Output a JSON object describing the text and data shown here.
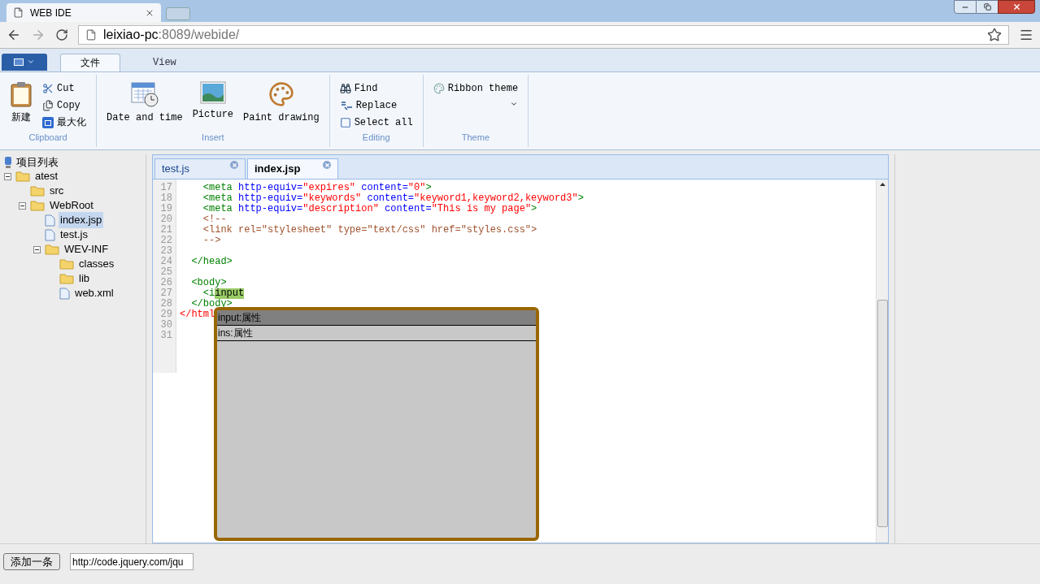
{
  "browser": {
    "tab_title": "WEB IDE",
    "url_host": "leixiao-pc",
    "url_path": ":8089/webide/"
  },
  "ribbon": {
    "tabs": [
      {
        "label": "文件",
        "selected": true
      },
      {
        "label": "View",
        "selected": false
      }
    ],
    "groups": [
      {
        "label": "Clipboard",
        "items": [
          {
            "label": "新建",
            "kind": "large"
          },
          {
            "label": "Cut",
            "kind": "small"
          },
          {
            "label": "Copy",
            "kind": "small"
          },
          {
            "label": "最大化",
            "kind": "small"
          }
        ]
      },
      {
        "label": "Insert",
        "items": [
          {
            "label": "Date and time",
            "kind": "large"
          },
          {
            "label": "Picture",
            "kind": "large"
          },
          {
            "label": "Paint drawing",
            "kind": "large"
          }
        ]
      },
      {
        "label": "Editing",
        "items": [
          {
            "label": "Find",
            "kind": "small"
          },
          {
            "label": "Replace",
            "kind": "small"
          },
          {
            "label": "Select all",
            "kind": "small"
          }
        ]
      },
      {
        "label": "Theme",
        "items": [
          {
            "label": "Ribbon theme",
            "kind": "dropdown"
          }
        ]
      }
    ]
  },
  "tree": {
    "title": "项目列表",
    "items": [
      {
        "label": "atest",
        "kind": "folder",
        "expanded": true,
        "selected": false,
        "children": [
          {
            "label": "src",
            "kind": "folder",
            "selected": false
          },
          {
            "label": "WebRoot",
            "kind": "folder",
            "expanded": true,
            "selected": false,
            "children": [
              {
                "label": "index.jsp",
                "kind": "file",
                "selected": true
              },
              {
                "label": "test.js",
                "kind": "file",
                "selected": false
              },
              {
                "label": "WEV-INF",
                "kind": "folder",
                "expanded": true,
                "selected": false,
                "children": [
                  {
                    "label": "classes",
                    "kind": "folder",
                    "selected": false
                  },
                  {
                    "label": "lib",
                    "kind": "folder",
                    "selected": false
                  },
                  {
                    "label": "web.xml",
                    "kind": "file",
                    "selected": false
                  }
                ]
              }
            ]
          }
        ]
      }
    ]
  },
  "editor": {
    "tabs": [
      {
        "label": "test.js",
        "selected": false
      },
      {
        "label": "index.jsp",
        "selected": true
      }
    ],
    "lines": [
      {
        "num": "17",
        "tokens": [
          {
            "text": "    <meta ",
            "kind": "tag"
          },
          {
            "text": "http-equiv=",
            "kind": "attr"
          },
          {
            "text": "\"expires\" ",
            "kind": "str"
          },
          {
            "text": "content=",
            "kind": "attr"
          },
          {
            "text": "\"0\"",
            "kind": "str"
          },
          {
            "text": ">",
            "kind": "tag"
          }
        ]
      },
      {
        "num": "18",
        "tokens": [
          {
            "text": "    <meta ",
            "kind": "tag"
          },
          {
            "text": "http-equiv=",
            "kind": "attr"
          },
          {
            "text": "\"keywords\" ",
            "kind": "str"
          },
          {
            "text": "content=",
            "kind": "attr"
          },
          {
            "text": "\"keyword1,keyword2,keyword3\"",
            "kind": "str"
          },
          {
            "text": ">",
            "kind": "tag"
          }
        ]
      },
      {
        "num": "19",
        "tokens": [
          {
            "text": "    <meta ",
            "kind": "tag"
          },
          {
            "text": "http-equiv=",
            "kind": "attr"
          },
          {
            "text": "\"description\" ",
            "kind": "str"
          },
          {
            "text": "content=",
            "kind": "attr"
          },
          {
            "text": "\"This is my page\"",
            "kind": "str"
          },
          {
            "text": ">",
            "kind": "tag"
          }
        ]
      },
      {
        "num": "20",
        "tokens": [
          {
            "text": "    <!--",
            "kind": "comment"
          }
        ]
      },
      {
        "num": "21",
        "tokens": [
          {
            "text": "    <link rel=\"stylesheet\" type=\"text/css\" href=\"styles.css\">",
            "kind": "comment"
          }
        ]
      },
      {
        "num": "22",
        "tokens": [
          {
            "text": "    -->",
            "kind": "comment"
          }
        ]
      },
      {
        "num": "23"
      },
      {
        "num": "24",
        "tokens": [
          {
            "text": "  </head>",
            "kind": "tag"
          }
        ]
      },
      {
        "num": "25"
      },
      {
        "num": "26",
        "tokens": [
          {
            "text": "  <body>",
            "kind": "tag"
          }
        ]
      },
      {
        "num": "27",
        "tokens": [
          {
            "text": "    <i",
            "kind": "tag"
          },
          {
            "text": "input",
            "kind": "highlight"
          }
        ]
      },
      {
        "num": "28",
        "tokens": [
          {
            "text": "  </body>",
            "kind": "tag"
          }
        ]
      },
      {
        "num": "29",
        "tokens": [
          {
            "text": "</html",
            "kind": "str"
          }
        ]
      },
      {
        "num": "30"
      },
      {
        "num": "31"
      }
    ],
    "completions": [
      {
        "label": "input:属性",
        "selected": true
      },
      {
        "label": "ins:属性",
        "selected": false
      }
    ]
  },
  "bottom": {
    "button": "添加一条",
    "url_value": "http://code.jquery.com/jqu"
  }
}
